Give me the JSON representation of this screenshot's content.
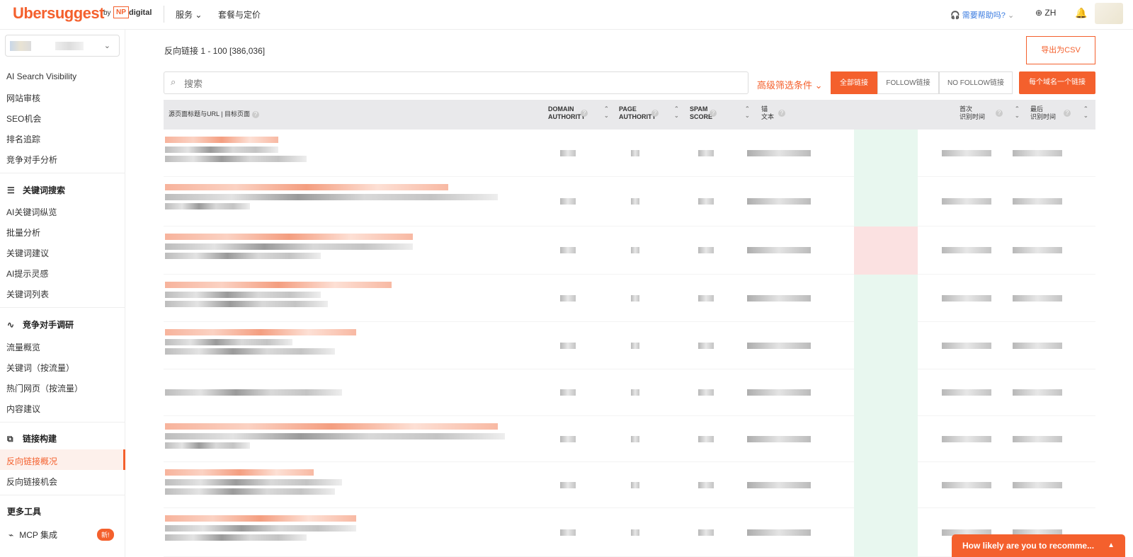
{
  "header": {
    "logo": "Ubersuggest",
    "by": "by",
    "np": "NP",
    "digital": "digital",
    "nav": [
      "服务",
      "套餐与定价"
    ],
    "help": "需要帮助吗?",
    "lang": "ZH"
  },
  "sidebar": {
    "items_top": [
      "AI Search Visibility",
      "网站审核",
      "SEO机会",
      "排名追踪",
      "竞争对手分析"
    ],
    "section_keywords": "关键词搜索",
    "items_keywords": [
      "AI关键词纵览",
      "批量分析",
      "关键词建议",
      "AI提示灵感",
      "关键词列表"
    ],
    "section_competitor": "竞争对手调研",
    "items_competitor": [
      "流量概览",
      "关键词（按流量）",
      "热门网页（按流量）",
      "内容建议"
    ],
    "section_links": "链接构建",
    "items_links": [
      "反向链接概况",
      "反向链接机会"
    ],
    "section_more": "更多工具",
    "mcp": "MCP 集成",
    "new_badge": "新!"
  },
  "main": {
    "title": "反向链接   1 - 100 [386,036]",
    "export": "导出为CSV",
    "search_placeholder": "搜索",
    "advanced": "高级筛选条件",
    "filters": [
      "全部链接",
      "FOLLOW链接",
      "NO FOLLOW链接"
    ],
    "per_domain": "每个域名一个链接"
  },
  "table": {
    "headers": {
      "source": "源页面标题与URL | 目标页面",
      "da": [
        "DOMAIN",
        "AUTHORITY"
      ],
      "pa": [
        "PAGE",
        "AUTHORITY"
      ],
      "spam": [
        "SPAM",
        "SCORE"
      ],
      "anchor": [
        "锚",
        "文本"
      ],
      "first": [
        "首次",
        "识别时间"
      ],
      "last": [
        "最后",
        "识别时间"
      ]
    }
  },
  "feedback": "How likely are you to recomme...",
  "colors": {
    "accent": "#f4602d",
    "spam_low": "#e8f7ef",
    "spam_high": "#fbe1e1"
  }
}
